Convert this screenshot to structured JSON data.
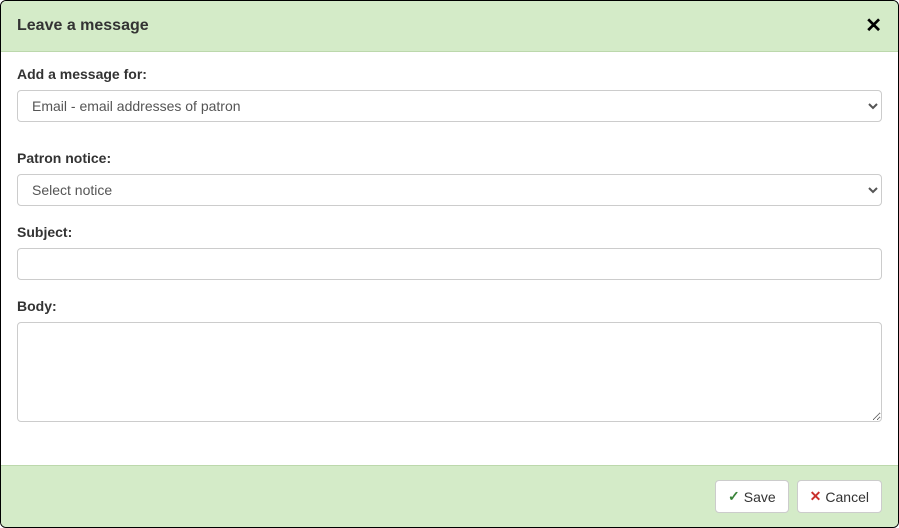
{
  "header": {
    "title": "Leave a message"
  },
  "form": {
    "message_for": {
      "label": "Add a message for:",
      "selected": "Email - email addresses of patron"
    },
    "patron_notice": {
      "label": "Patron notice:",
      "selected": "Select notice"
    },
    "subject": {
      "label": "Subject:",
      "value": ""
    },
    "body": {
      "label": "Body:",
      "value": ""
    }
  },
  "footer": {
    "save_label": "Save",
    "cancel_label": "Cancel"
  }
}
